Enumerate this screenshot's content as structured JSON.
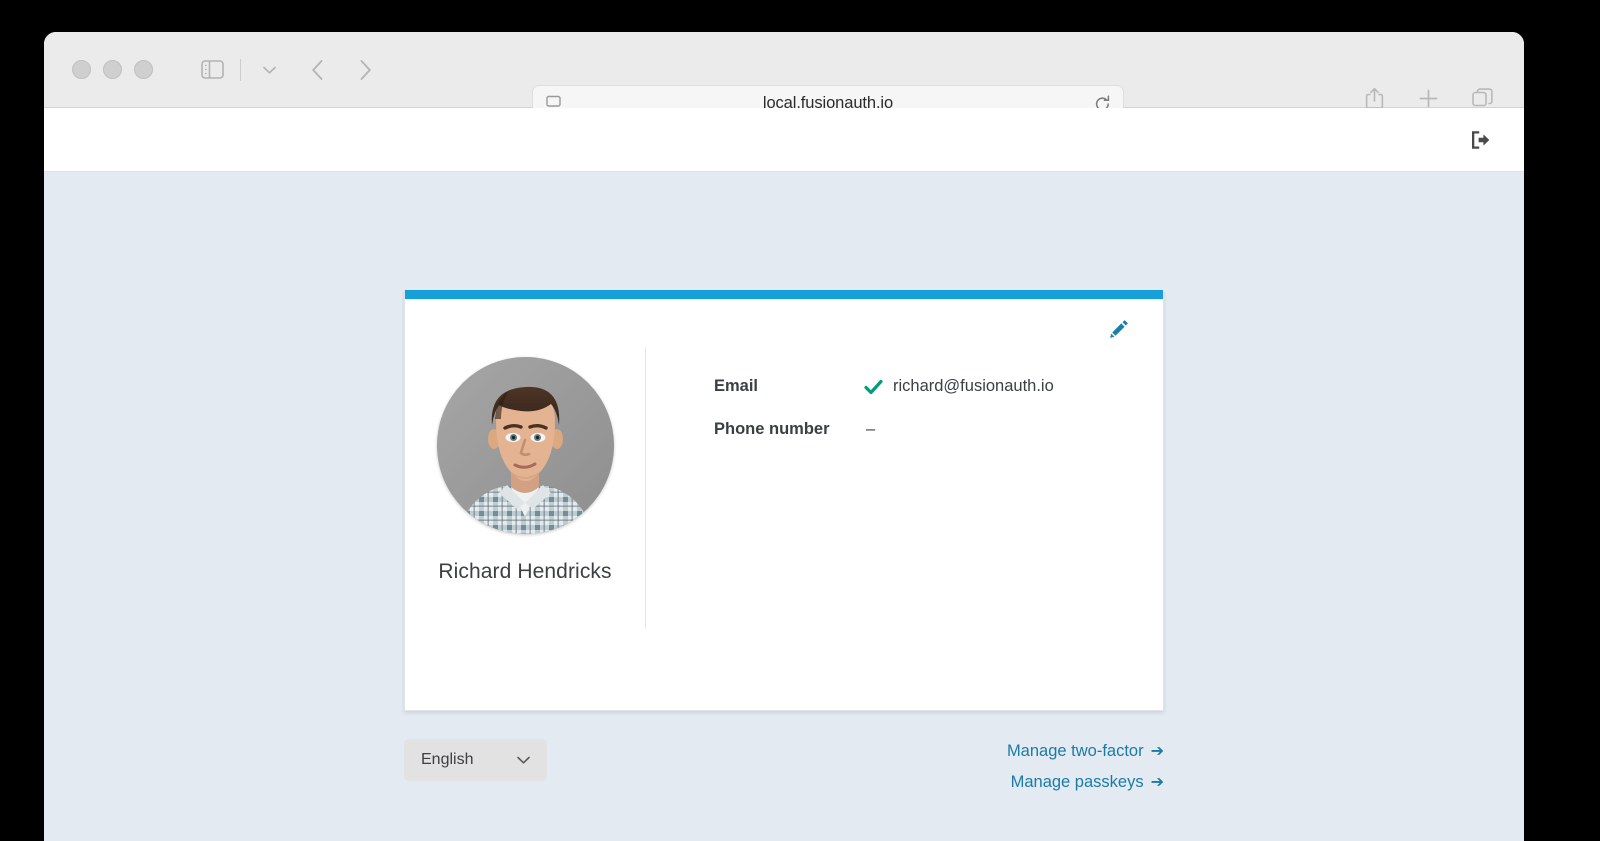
{
  "browser": {
    "url": "local.fusionauth.io",
    "traffic_lights": [
      "close-button",
      "minimize-button",
      "zoom-button"
    ],
    "toolbar_icons": {
      "sidebar": "sidebar-toggle-icon",
      "sidebar_chevron": "chevron-down-icon",
      "back": "back-arrow-icon",
      "forward": "forward-arrow-icon",
      "reader": "page-settings-icon",
      "reload": "reload-icon",
      "share": "share-icon",
      "new_tab": "plus-icon",
      "tab_overview": "tab-overview-icon"
    }
  },
  "page_header": {
    "logout_icon": "logout-icon"
  },
  "profile": {
    "name": "Richard Hendricks",
    "avatar_alt": "user-avatar-photo",
    "edit_icon": "pencil-icon",
    "details": [
      {
        "label": "Email",
        "value": "richard@fusionauth.io",
        "verified": true
      },
      {
        "label": "Phone number",
        "value": "–",
        "verified": false
      }
    ]
  },
  "footer": {
    "language": {
      "selected": "English",
      "chevron_icon": "chevron-down-icon"
    },
    "links": [
      {
        "label": "Manage two-factor",
        "arrow": "➔"
      },
      {
        "label": "Manage passkeys",
        "arrow": "➔"
      }
    ]
  },
  "colors": {
    "accent_blue": "#169fd8",
    "link_blue": "#1c7ba5",
    "verified_green": "#009d78",
    "page_background": "#e3eaf2",
    "edit_icon_blue": "#1a7fae"
  }
}
